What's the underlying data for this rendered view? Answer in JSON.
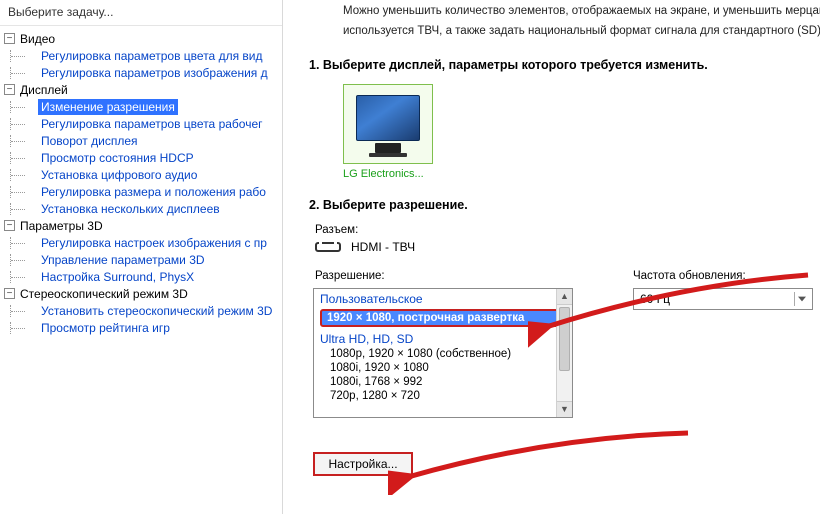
{
  "sidebar": {
    "title": "Выберите задачу...",
    "groups": [
      {
        "label": "Видео",
        "items": [
          "Регулировка параметров цвета для вид",
          "Регулировка параметров изображения д"
        ]
      },
      {
        "label": "Дисплей",
        "items": [
          "Изменение разрешения",
          "Регулировка параметров цвета рабочег",
          "Поворот дисплея",
          "Просмотр состояния HDCP",
          "Установка цифрового аудио",
          "Регулировка размера и положения рабо",
          "Установка нескольких дисплеев"
        ],
        "selected_index": 0
      },
      {
        "label": "Параметры 3D",
        "items": [
          "Регулировка настроек изображения с пр",
          "Управление параметрами 3D",
          "Настройка Surround, PhysX"
        ]
      },
      {
        "label": "Стереоскопический режим 3D",
        "items": [
          "Установить стереоскопический режим 3D",
          "Просмотр рейтинга игр"
        ]
      }
    ]
  },
  "main": {
    "desc_line1": "Можно уменьшить количество элементов, отображаемых на экране, и уменьшить мерцание. Мож",
    "desc_line2": "используется ТВЧ, а также задать национальный формат сигнала для стандартного (SD) телеви",
    "step1_title": "1. Выберите дисплей, параметры которого требуется изменить.",
    "monitor_name": "LG Electronics...",
    "step2_title": "2. Выберите разрешение.",
    "connector_label": "Разъем:",
    "connector_value": "HDMI - ТВЧ",
    "resolution_label": "Разрешение:",
    "res_header1": "Пользовательское",
    "res_selected": "1920 × 1080, построчная развертка",
    "res_header2": "Ultra HD, HD, SD",
    "res_options": [
      "1080p, 1920 × 1080 (собственное)",
      "1080i, 1920 × 1080",
      "1080i, 1768 × 992",
      "720p, 1280 × 720"
    ],
    "refresh_label": "Частота обновления:",
    "refresh_value": "60 Гц",
    "settings_button": "Настройка..."
  }
}
